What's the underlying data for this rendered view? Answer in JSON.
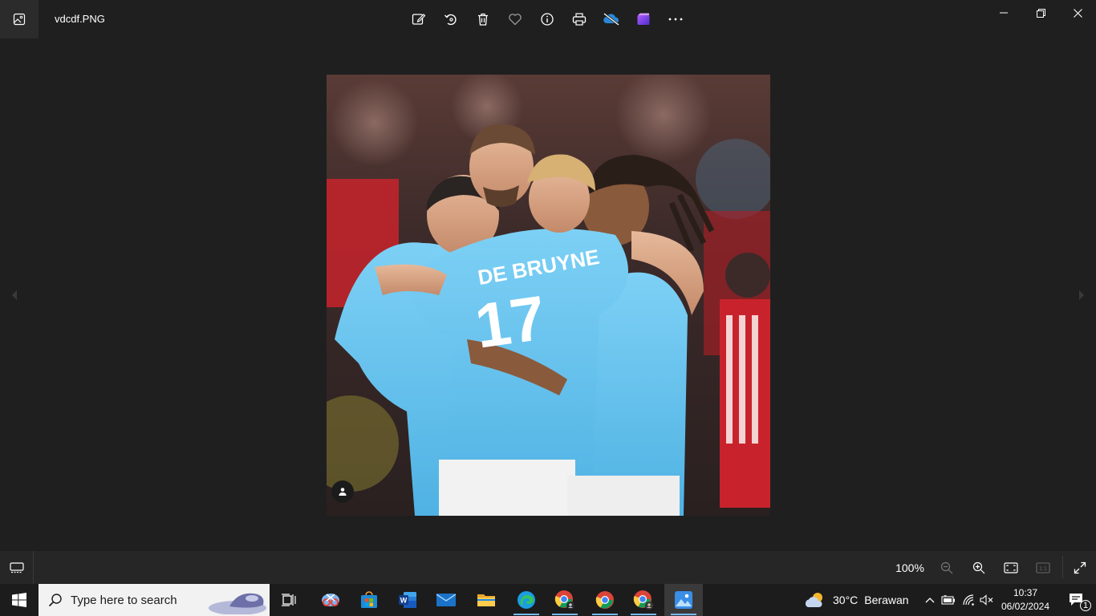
{
  "window": {
    "filename": "vdcdf.PNG",
    "toolbar": [
      {
        "icon": "edit-image-icon"
      },
      {
        "icon": "rotate-icon"
      },
      {
        "icon": "delete-icon"
      },
      {
        "icon": "favorite-heart-icon"
      },
      {
        "icon": "info-icon"
      },
      {
        "icon": "print-icon"
      },
      {
        "icon": "onedrive-offline-icon"
      },
      {
        "icon": "clipchamp-icon"
      },
      {
        "icon": "more-options-icon"
      }
    ]
  },
  "photo": {
    "jersey_name": "DE BRUYNE",
    "jersey_number": "17",
    "colors": {
      "sky_blue": "#6cc5ef",
      "crowd": "#4a2a2a",
      "red": "#c8232c"
    }
  },
  "bottombar": {
    "zoom_level": "100%"
  },
  "taskbar": {
    "search_placeholder": "Type here to search",
    "weather_temp": "30°C",
    "weather_desc": "Berawan",
    "time": "10:37",
    "date": "06/02/2024",
    "notification_count": "1"
  },
  "colors": {
    "app_bg": "#1f1f1f",
    "bottombar_bg": "#262626",
    "taskbar_bg": "#1c1c1c",
    "accent": "#76b9ed"
  }
}
